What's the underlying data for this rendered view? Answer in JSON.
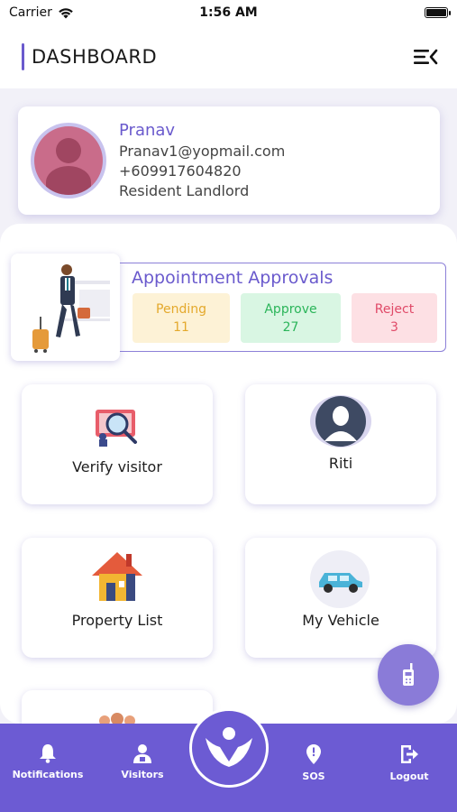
{
  "status_bar": {
    "carrier": "Carrier",
    "time": "1:56 AM"
  },
  "header": {
    "title": "DASHBOARD",
    "menu_icon": "menu-collapse-icon"
  },
  "profile": {
    "name": "Pranav",
    "email": "Pranav1@yopmail.com",
    "phone": "+609917604820",
    "role": "Resident Landlord",
    "avatar_icon": "user-avatar-icon"
  },
  "appointments": {
    "title": "Appointment Approvals",
    "pending": {
      "label": "Pending",
      "count": "11"
    },
    "approve": {
      "label": "Approve",
      "count": "27"
    },
    "reject": {
      "label": "Reject",
      "count": "3"
    }
  },
  "tiles": {
    "verify_visitor": "Verify visitor",
    "riti": "Riti",
    "property_list": "Property List",
    "my_vehicle": "My Vehicle"
  },
  "bottom_nav": {
    "notifications": "Notifications",
    "visitors": "Visitors",
    "sos": "SOS",
    "logout": "Logout"
  },
  "colors": {
    "accent": "#6a5acd",
    "nav_bg": "#6c5bd3",
    "fab_bg": "#8a7bd8"
  }
}
